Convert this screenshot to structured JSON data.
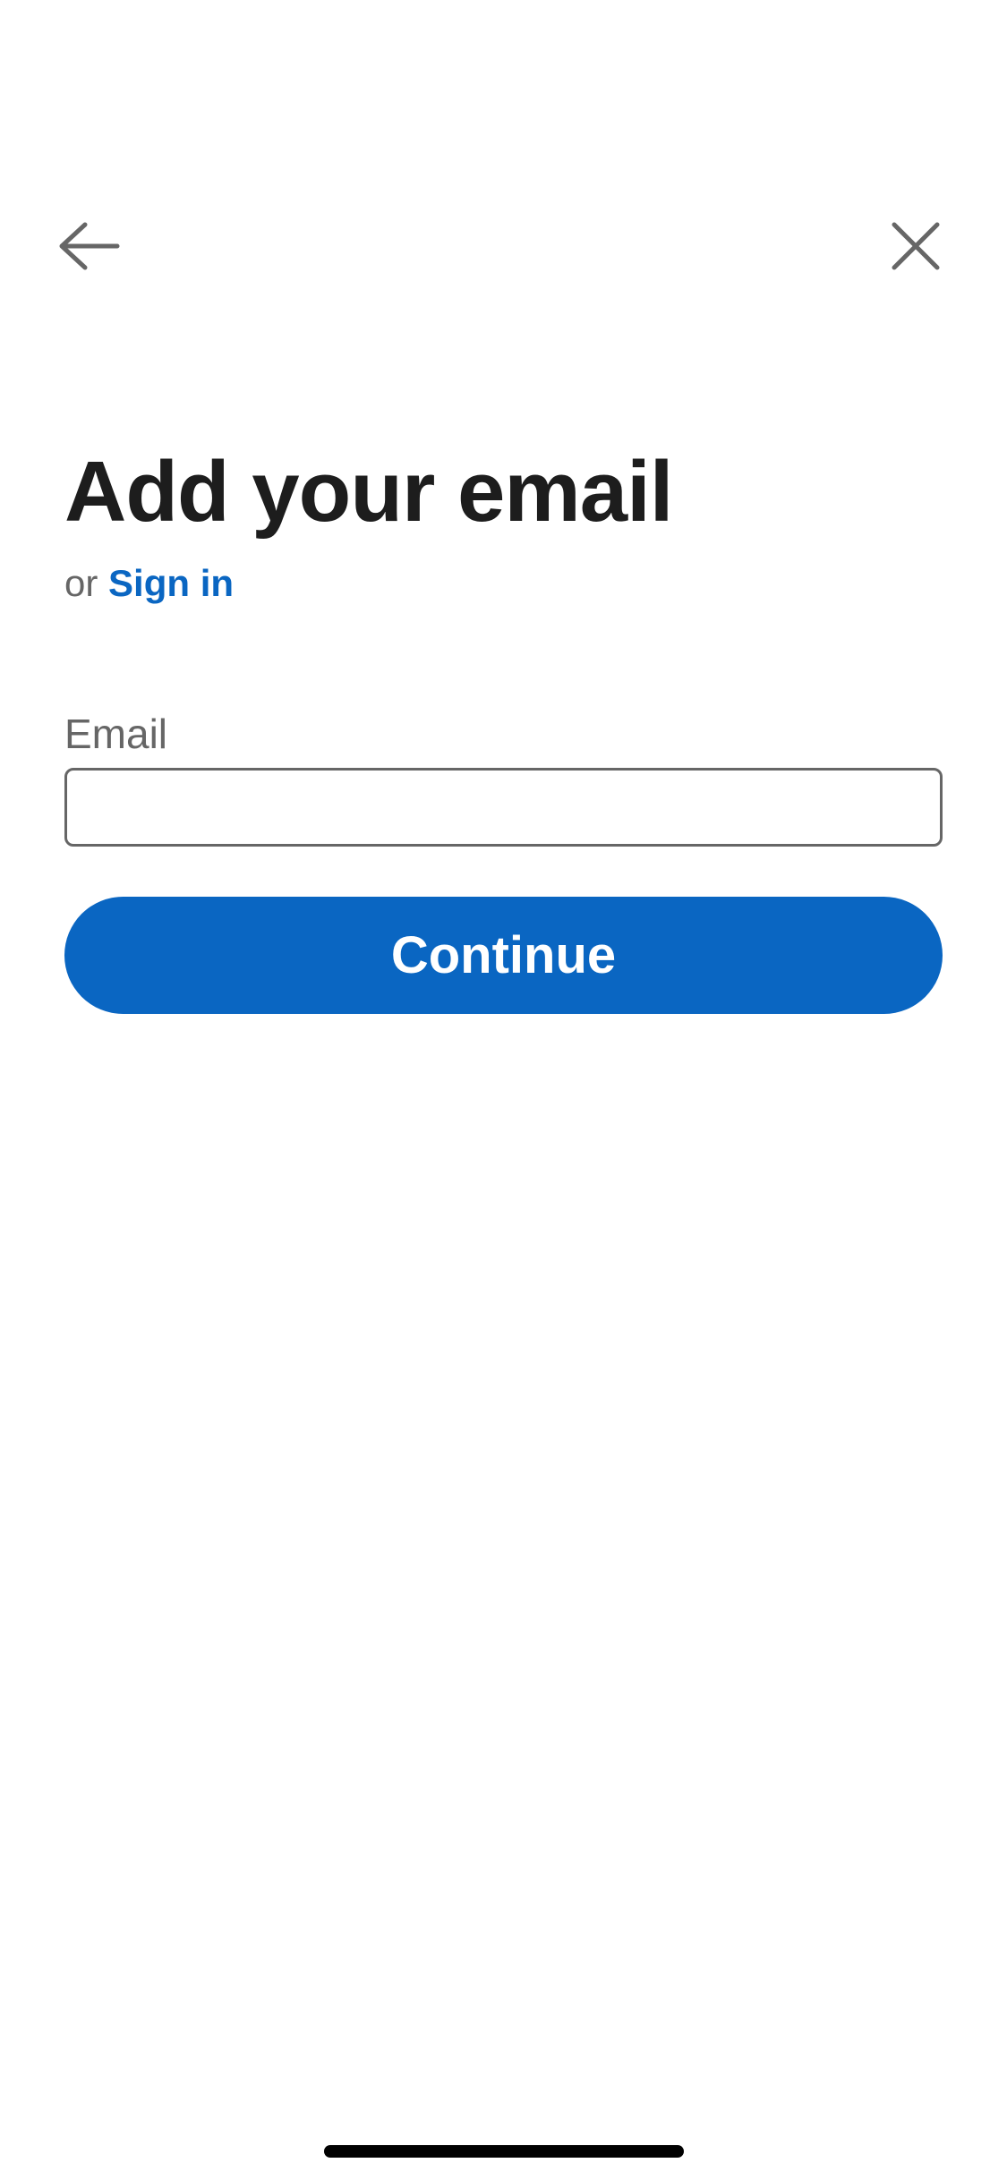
{
  "header": {
    "back_icon": "arrow-left-icon",
    "close_icon": "close-icon",
    "icon_color": "#666666"
  },
  "main": {
    "title": "Add your email",
    "signin_prefix": "or",
    "signin_link": "Sign in",
    "email_label": "Email",
    "email_value": "",
    "email_placeholder": "",
    "continue_label": "Continue"
  },
  "colors": {
    "accent": "#0a66c2",
    "title_text": "#1d1d1d",
    "secondary_text": "#666666",
    "background": "#ffffff"
  }
}
